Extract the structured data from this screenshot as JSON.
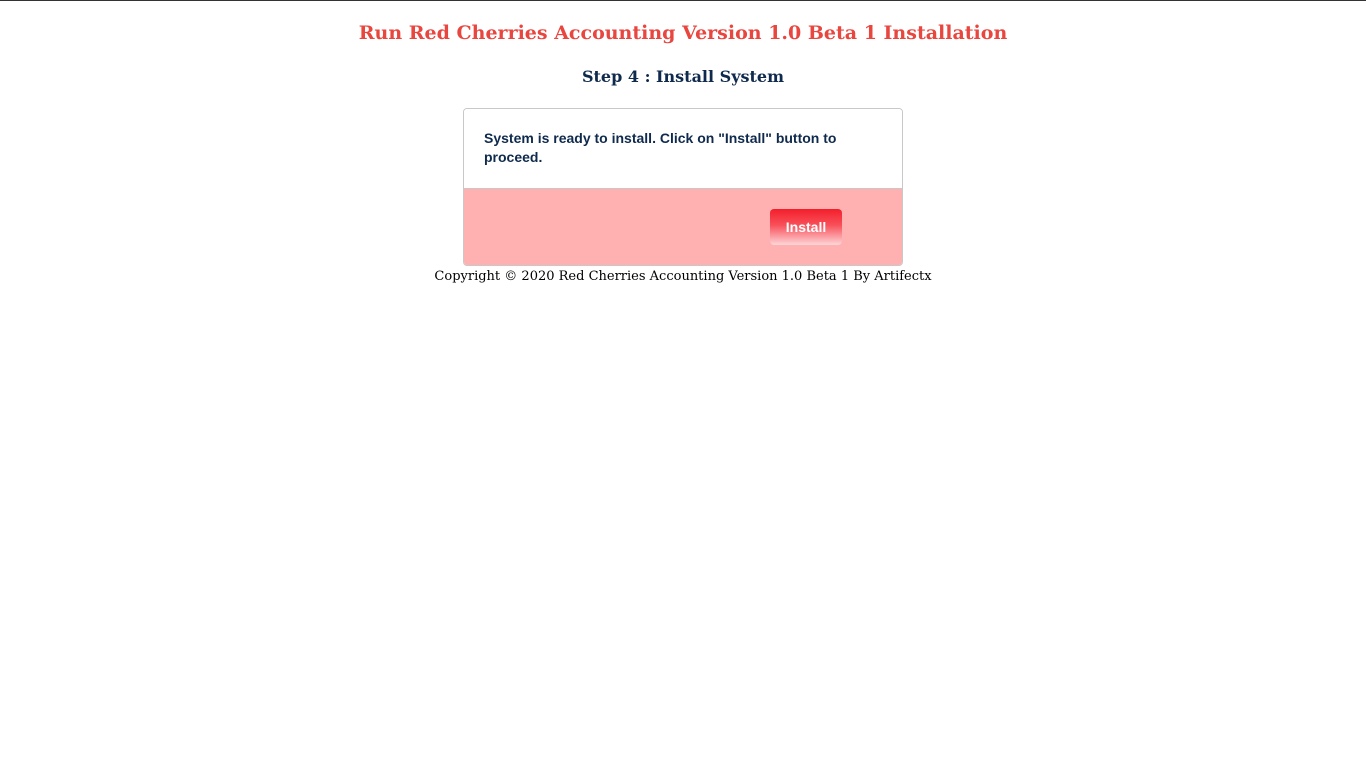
{
  "header": {
    "title": "Run Red Cherries Accounting Version 1.0 Beta 1 Installation",
    "step_title": "Step 4 : Install System"
  },
  "panel": {
    "message": "System is ready to install. Click on \"Install\" button to proceed.",
    "install_label": "Install"
  },
  "footer": {
    "copyright": "Copyright © 2020 Red Cherries Accounting Version 1.0 Beta 1 By Artifectx"
  },
  "colors": {
    "title": "#e8463f",
    "heading": "#0f2a4d",
    "footer_panel": "#ffb0b0",
    "button": "#f31f2b"
  }
}
